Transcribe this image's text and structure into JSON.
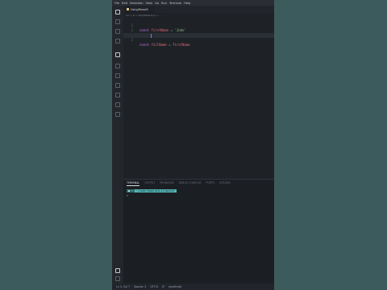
{
  "menubar": {
    "items": [
      "File",
      "Edit",
      "Selection",
      "View",
      "Go",
      "Run",
      "Terminal",
      "Help"
    ]
  },
  "editor": {
    "tab_label": "UsingTemplS",
    "breadcrumb": "src > js > templateLit.js > ...",
    "lines": [
      {
        "num": "1",
        "kw": "const",
        "name": "firstName",
        "op": "=",
        "value": "'John'"
      },
      {
        "num": "2",
        "kw": "const",
        "name": "lastName",
        "op": "=",
        "value": "'Doe'"
      },
      {
        "num": "3",
        "kw": "const",
        "name": "fullName",
        "op": "=",
        "value": "firstName"
      }
    ]
  },
  "panel": {
    "tabs": [
      "TERMINAL",
      "OUTPUT",
      "PROBLEMS",
      "DEBUG CONSOLE",
      "PORTS",
      "GITLENS"
    ],
    "prompt": "",
    "path": "~/code/templateLit/master",
    "cursor_line": ">"
  },
  "statusbar": {
    "items": [
      "Ln 3, Col 7",
      "Spaces: 2",
      "UTF-8",
      "LF",
      "JavaScript"
    ]
  },
  "colors": {
    "background": "#3c5b5c",
    "editor_bg": "#1e2227",
    "keyword": "#c678dd",
    "variable": "#e06c75",
    "string": "#98c379",
    "terminal_path": "#56b6b6"
  }
}
